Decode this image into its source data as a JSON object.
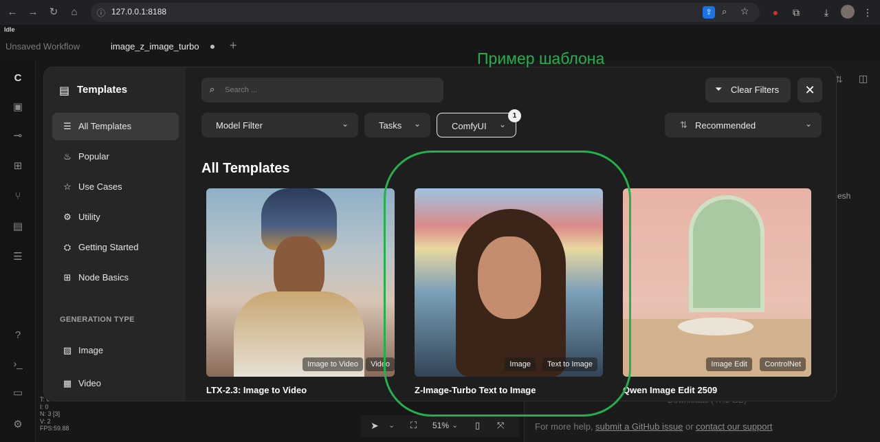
{
  "browser": {
    "url": "127.0.0.1:8188"
  },
  "app": {
    "status": "Idle",
    "tabs": [
      {
        "label": "Unsaved Workflow",
        "active": false
      },
      {
        "label": "image_z_image_turbo",
        "active": true
      }
    ],
    "stats": [
      "T: 0",
      "I: 0",
      "N: 3 [3]",
      "V: 2",
      "FPS:59.88"
    ],
    "zoom": "51%",
    "help_prefix": "For more help,",
    "help_link1": "submit a GitHub issue",
    "help_or": "or",
    "help_link2": "contact our support",
    "right_panel_fragment": "esh",
    "right_panel_fragment2": "Downloads (47.6 GB)"
  },
  "modal": {
    "title": "Templates",
    "nav": [
      {
        "label": "All Templates",
        "icon": "list-icon",
        "active": true
      },
      {
        "label": "Popular",
        "icon": "flame-icon",
        "active": false
      },
      {
        "label": "Use Cases",
        "icon": "star-icon",
        "active": false
      },
      {
        "label": "Utility",
        "icon": "gear-icon",
        "active": false
      },
      {
        "label": "Getting Started",
        "icon": "graduation-cap-icon",
        "active": false
      },
      {
        "label": "Node Basics",
        "icon": "grid-plus-icon",
        "active": false
      }
    ],
    "generation_type_heading": "GENERATION TYPE",
    "generation_types": [
      {
        "label": "Image",
        "icon": "image-icon"
      },
      {
        "label": "Video",
        "icon": "film-icon"
      }
    ],
    "search_placeholder": "Search ...",
    "clear_filters": "Clear Filters",
    "filters": {
      "model": "Model Filter",
      "tasks": "Tasks",
      "comfyui": "ComfyUI",
      "comfyui_count": "1",
      "sort": "Recommended"
    },
    "annotation": "Пример шаблона",
    "section_title": "All Templates",
    "cards": [
      {
        "title": "LTX-2.3: Image to Video",
        "tags": [
          "Image to Video",
          "Video"
        ]
      },
      {
        "title": "Z-Image-Turbo Text to Image",
        "tags": [
          "Image",
          "Text to Image"
        ]
      },
      {
        "title": "Qwen Image Edit 2509",
        "tags": [
          "Image Edit",
          "ControlNet"
        ]
      }
    ]
  }
}
